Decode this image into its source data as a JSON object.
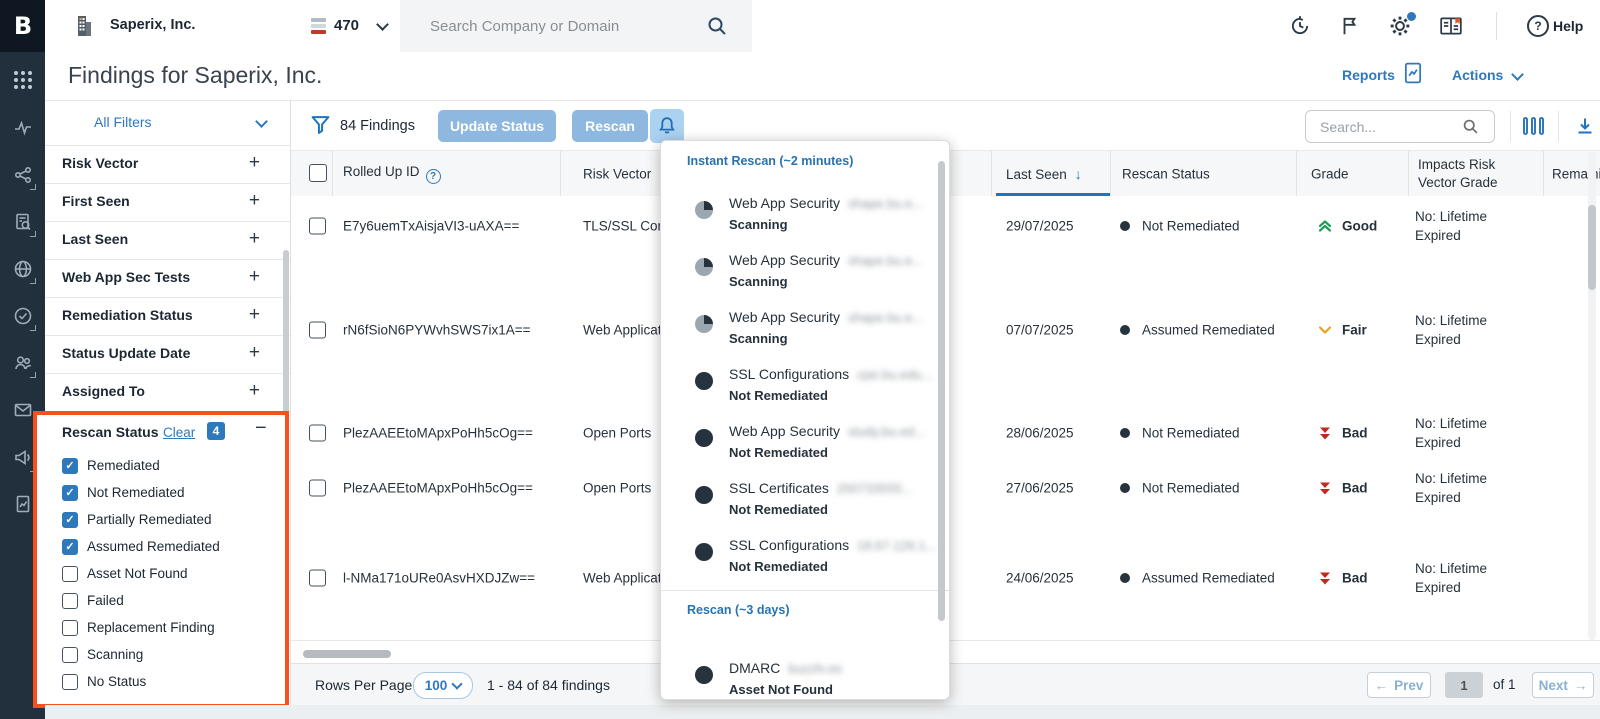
{
  "topbar": {
    "company": "Saperix, Inc.",
    "rating": "470",
    "search_placeholder": "Search Company or Domain",
    "help_label": "Help"
  },
  "page": {
    "title": "Findings for Saperix, Inc.",
    "reports_label": "Reports",
    "actions_label": "Actions"
  },
  "filters": {
    "all_filters_label": "All Filters",
    "sections": [
      "Risk Vector",
      "First Seen",
      "Last Seen",
      "Web App Sec Tests",
      "Remediation Status",
      "Status Update Date",
      "Assigned To"
    ],
    "rescan_status": {
      "title": "Rescan Status",
      "clear_label": "Clear",
      "selected_count": "4",
      "options": [
        {
          "label": "Remediated",
          "checked": true
        },
        {
          "label": "Not Remediated",
          "checked": true
        },
        {
          "label": "Partially Remediated",
          "checked": true
        },
        {
          "label": "Assumed Remediated",
          "checked": true
        },
        {
          "label": "Asset Not Found",
          "checked": false
        },
        {
          "label": "Failed",
          "checked": false
        },
        {
          "label": "Replacement Finding",
          "checked": false
        },
        {
          "label": "Scanning",
          "checked": false
        },
        {
          "label": "No Status",
          "checked": false
        }
      ]
    }
  },
  "toolbar": {
    "findings_count": "84 Findings",
    "update_status_label": "Update Status",
    "rescan_label": "Rescan",
    "search_placeholder": "Search..."
  },
  "table": {
    "headers": {
      "rolled_up_id": "Rolled Up ID",
      "risk_vector": "Risk Vector",
      "last_seen": "Last Seen",
      "rescan_status": "Rescan Status",
      "grade": "Grade",
      "impacts": "Impacts Risk Vector Grade",
      "remaining": "Remaining"
    },
    "rows": [
      {
        "id": "E7y6uemTxAisjaVI3-uAXA==",
        "risk_vector": "TLS/SSL Configurations",
        "last_seen": "29/07/2025",
        "rescan_status": "Not Remediated",
        "grade": "Good",
        "grade_type": "good",
        "impacts": "No: Lifetime Expired"
      },
      {
        "id": "rN6fSioN6PYWvhSWS7ix1A==",
        "risk_vector": "Web Application Headers",
        "last_seen": "07/07/2025",
        "rescan_status": "Assumed Remediated",
        "grade": "Fair",
        "grade_type": "fair",
        "impacts": "No: Lifetime Expired"
      },
      {
        "id": "PlezAAEEtoMApxPoHh5cOg==",
        "risk_vector": "Open Ports",
        "last_seen": "28/06/2025",
        "rescan_status": "Not Remediated",
        "grade": "Bad",
        "grade_type": "bad",
        "impacts": "No: Lifetime Expired"
      },
      {
        "id": "PlezAAEEtoMApxPoHh5cOg==",
        "risk_vector": "Open Ports",
        "last_seen": "27/06/2025",
        "rescan_status": "Not Remediated",
        "grade": "Bad",
        "grade_type": "bad",
        "impacts": "No: Lifetime Expired"
      },
      {
        "id": "l-NMa171oURe0AsvHXDJZw==",
        "risk_vector": "Web Application Headers",
        "last_seen": "24/06/2025",
        "rescan_status": "Assumed Remediated",
        "grade": "Bad",
        "grade_type": "bad",
        "impacts": "No: Lifetime Expired"
      }
    ]
  },
  "rescan_panel": {
    "instant_header": "Instant Rescan (~2 minutes)",
    "instant_items": [
      {
        "title": "Web App Security",
        "value": "shape.bu.e...",
        "status": "Scanning",
        "icon": "scanning"
      },
      {
        "title": "Web App Security",
        "value": "shape.bu.e...",
        "status": "Scanning",
        "icon": "scanning"
      },
      {
        "title": "Web App Security",
        "value": "shape.bu.e...",
        "status": "Scanning",
        "icon": "scanning"
      },
      {
        "title": "SSL Configurations",
        "value": "cpe.bu.edu...",
        "status": "Not Remediated",
        "icon": "solid"
      },
      {
        "title": "Web App Security",
        "value": "study.bu.ed...",
        "status": "Not Remediated",
        "icon": "solid"
      },
      {
        "title": "SSL Certificates",
        "value": "200733555...",
        "status": "Not Remediated",
        "icon": "solid"
      },
      {
        "title": "SSL Configurations",
        "value": "18.67.126.1...",
        "status": "Not Remediated",
        "icon": "solid"
      }
    ],
    "delayed_header": "Rescan (~3 days)",
    "delayed_items": [
      {
        "title": "DMARC",
        "value": "buzzfv.es",
        "status": "Asset Not Found",
        "icon": "solid"
      }
    ]
  },
  "footer": {
    "rows_per_page_label": "Rows Per Page",
    "rows_per_page_value": "100",
    "range_text": "1 - 84 of 84 findings",
    "prev_label": "Prev",
    "page_number": "1",
    "of_label": "of 1",
    "next_label": "Next"
  },
  "colors": {
    "accent_blue": "#2e78bc",
    "orange_highlight": "#f4511e",
    "grade_good": "#1f9d57",
    "grade_fair": "#e8a21d",
    "grade_bad": "#c1281e",
    "rail_background": "#22303e"
  }
}
